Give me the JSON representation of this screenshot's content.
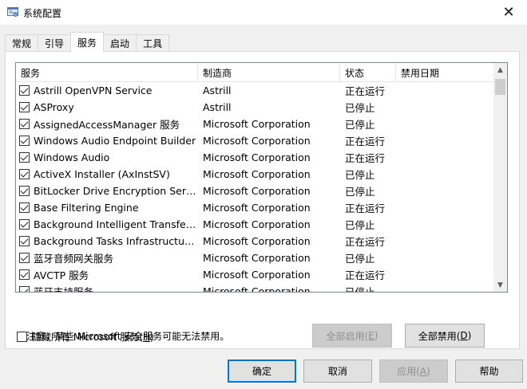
{
  "window": {
    "title": "系统配置",
    "close_label": "✕"
  },
  "tabs": [
    {
      "label": "常规",
      "active": false
    },
    {
      "label": "引导",
      "active": false
    },
    {
      "label": "服务",
      "active": true
    },
    {
      "label": "启动",
      "active": false
    },
    {
      "label": "工具",
      "active": false
    }
  ],
  "list": {
    "columns": [
      "服务",
      "制造商",
      "状态",
      "禁用日期"
    ],
    "rows": [
      {
        "checked": true,
        "name": "Astrill OpenVPN Service",
        "vendor": "Astrill",
        "status": "正在运行",
        "disabled_date": ""
      },
      {
        "checked": true,
        "name": "ASProxy",
        "vendor": "Astrill",
        "status": "已停止",
        "disabled_date": ""
      },
      {
        "checked": true,
        "name": "AssignedAccessManager 服务",
        "vendor": "Microsoft Corporation",
        "status": "已停止",
        "disabled_date": ""
      },
      {
        "checked": true,
        "name": "Windows Audio Endpoint Builder",
        "vendor": "Microsoft Corporation",
        "status": "正在运行",
        "disabled_date": ""
      },
      {
        "checked": true,
        "name": "Windows Audio",
        "vendor": "Microsoft Corporation",
        "status": "正在运行",
        "disabled_date": ""
      },
      {
        "checked": true,
        "name": "ActiveX Installer (AxInstSV)",
        "vendor": "Microsoft Corporation",
        "status": "已停止",
        "disabled_date": ""
      },
      {
        "checked": true,
        "name": "BitLocker Drive Encryption Service",
        "vendor": "Microsoft Corporation",
        "status": "已停止",
        "disabled_date": ""
      },
      {
        "checked": true,
        "name": "Base Filtering Engine",
        "vendor": "Microsoft Corporation",
        "status": "正在运行",
        "disabled_date": ""
      },
      {
        "checked": true,
        "name": "Background Intelligent Transfer ...",
        "vendor": "Microsoft Corporation",
        "status": "已停止",
        "disabled_date": ""
      },
      {
        "checked": true,
        "name": "Background Tasks Infrastructure...",
        "vendor": "Microsoft Corporation",
        "status": "正在运行",
        "disabled_date": ""
      },
      {
        "checked": true,
        "name": "蓝牙音频网关服务",
        "vendor": "Microsoft Corporation",
        "status": "已停止",
        "disabled_date": ""
      },
      {
        "checked": true,
        "name": "AVCTP 服务",
        "vendor": "Microsoft Corporation",
        "status": "正在运行",
        "disabled_date": ""
      },
      {
        "checked": true,
        "name": "蓝牙支持服务",
        "vendor": "Microsoft Corporation",
        "status": "已停止",
        "disabled_date": ""
      }
    ]
  },
  "notice": "请注意，某些 Microsoft 安全服务可能无法禁用。",
  "enable_all": {
    "text": "全部启用(",
    "key": "E",
    "end": ")"
  },
  "disable_all": {
    "text": "全部禁用(",
    "key": "D",
    "end": ")"
  },
  "hide_ms": {
    "text": "隐藏所有 Microsoft 服务(",
    "key": "H",
    "end": ")",
    "checked": false
  },
  "footer": {
    "ok": "确定",
    "cancel": "取消",
    "apply": {
      "text": "应用(",
      "key": "A",
      "end": ")"
    },
    "help": "帮助"
  },
  "icons": {
    "app": "msconfig-icon",
    "scroll_up": "chevron-up-icon",
    "scroll_down": "chevron-down-icon"
  }
}
